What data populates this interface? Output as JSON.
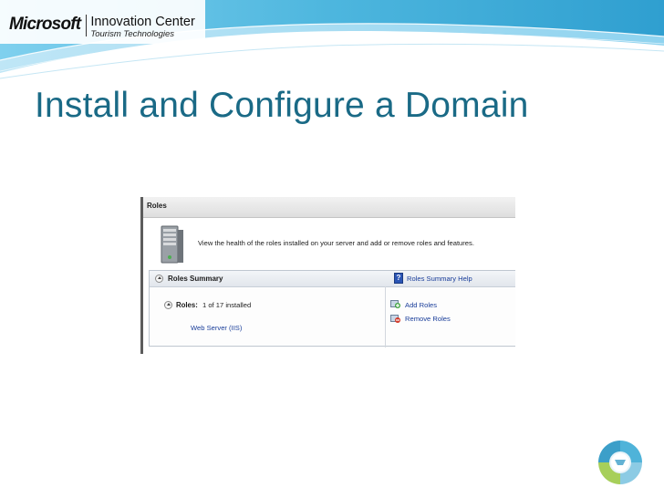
{
  "header": {
    "brand": "Microsoft",
    "center_name": "Innovation Center",
    "center_tagline": "Tourism Technologies"
  },
  "slide": {
    "title": "Install and Configure a Domain"
  },
  "roles_panel": {
    "title": "Roles",
    "description": "View the health of the roles installed on your server and add or remove roles and features.",
    "summary": {
      "title": "Roles Summary",
      "help_link": "Roles Summary Help",
      "roles_label": "Roles:",
      "roles_count": "1 of 17 installed",
      "installed_roles": [
        "Web Server (IIS)"
      ],
      "actions": {
        "add_roles": "Add Roles",
        "remove_roles": "Remove Roles"
      }
    }
  },
  "colors": {
    "title_teal": "#1a6a86",
    "band_blue": "#4fb7df",
    "link_blue": "#1a3e9a"
  },
  "icons": {
    "server": "server-icon",
    "help": "help-icon",
    "add": "add-roles-icon",
    "remove": "remove-roles-icon",
    "collapse": "chevron-up-icon",
    "corner": "innovation-center-logo-icon"
  }
}
